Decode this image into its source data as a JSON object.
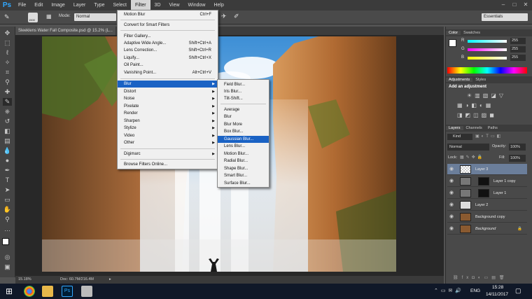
{
  "app": {
    "logo": "Ps"
  },
  "menubar": {
    "items": [
      "File",
      "Edit",
      "Image",
      "Layer",
      "Type",
      "Select",
      "Filter",
      "3D",
      "View",
      "Window",
      "Help"
    ]
  },
  "options": {
    "brush_size": "1500",
    "mode_label": "Mode:",
    "mode_value": "Normal",
    "workspace": "Essentials"
  },
  "document": {
    "tab_title": "Sleeklens Water Fall Composite.psd @ 15.2% (L...",
    "zoom": "15.18%",
    "doc_size": "Doc: 60.7M/216.4M"
  },
  "filter_menu": {
    "items": [
      {
        "label": "Motion Blur",
        "shortcut": "Ctrl+F"
      },
      {
        "label": "Convert for Smart Filters",
        "shortcut": ""
      },
      {
        "label": "Filter Gallery...",
        "shortcut": ""
      },
      {
        "label": "Adaptive Wide Angle...",
        "shortcut": "Shift+Ctrl+A"
      },
      {
        "label": "Lens Correction...",
        "shortcut": "Shift+Ctrl+R"
      },
      {
        "label": "Liquify...",
        "shortcut": "Shift+Ctrl+X"
      },
      {
        "label": "Oil Paint...",
        "shortcut": ""
      },
      {
        "label": "Vanishing Point...",
        "shortcut": "Alt+Ctrl+V"
      },
      {
        "label": "Blur",
        "shortcut": ""
      },
      {
        "label": "Distort",
        "shortcut": ""
      },
      {
        "label": "Noise",
        "shortcut": ""
      },
      {
        "label": "Pixelate",
        "shortcut": ""
      },
      {
        "label": "Render",
        "shortcut": ""
      },
      {
        "label": "Sharpen",
        "shortcut": ""
      },
      {
        "label": "Stylize",
        "shortcut": ""
      },
      {
        "label": "Video",
        "shortcut": ""
      },
      {
        "label": "Other",
        "shortcut": ""
      },
      {
        "label": "Digimarc",
        "shortcut": ""
      },
      {
        "label": "Browse Filters Online...",
        "shortcut": ""
      }
    ]
  },
  "blur_submenu": {
    "items": [
      "Field Blur...",
      "Iris Blur...",
      "Tilt-Shift...",
      "Average",
      "Blur",
      "Blur More",
      "Box Blur...",
      "Gaussian Blur...",
      "Lens Blur...",
      "Motion Blur...",
      "Radial Blur...",
      "Shape Blur...",
      "Smart Blur...",
      "Surface Blur..."
    ],
    "highlighted": "Gaussian Blur..."
  },
  "color_panel": {
    "tabs": [
      "Color",
      "Swatches"
    ],
    "r": "255",
    "g": "255",
    "b": "255"
  },
  "adjustments_panel": {
    "tabs": [
      "Adjustments",
      "Styles"
    ],
    "hint": "Add an adjustment"
  },
  "layers_panel": {
    "tabs": [
      "Layers",
      "Channels",
      "Paths"
    ],
    "kind": "Kind",
    "blend_mode": "Normal",
    "opacity_label": "Opacity:",
    "opacity": "100%",
    "lock_label": "Lock:",
    "fill_label": "Fill:",
    "fill": "100%",
    "layers": [
      "Layer 3",
      "Layer 1 copy",
      "Layer 1",
      "Layer 2",
      "Background copy",
      "Background"
    ]
  },
  "taskbar": {
    "language": "ENG",
    "time": "15:28",
    "date": "14/11/2017"
  },
  "colors": {
    "highlight": "#1a62c4",
    "ps_blue": "#31a8ff",
    "layer_selected": "#6b7e9a"
  }
}
